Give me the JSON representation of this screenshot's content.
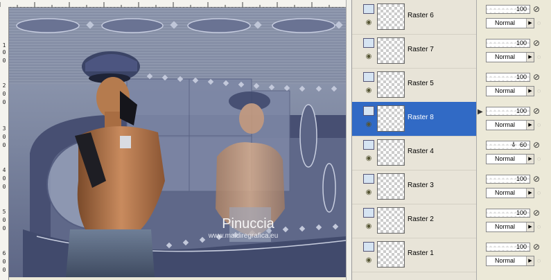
{
  "canvas": {
    "watermark_name": "Pinuccia",
    "watermark_url": "www.maidiregrafica.eu"
  },
  "ruler": {
    "left_ticks": [
      "1",
      "0",
      "0",
      "2",
      "0",
      "0",
      "3",
      "0",
      "0",
      "4",
      "0",
      "0",
      "5",
      "0",
      "0",
      "6",
      "0",
      "0"
    ]
  },
  "layers": [
    {
      "name": "Raster 6",
      "selected": false
    },
    {
      "name": "Raster 7",
      "selected": false
    },
    {
      "name": "Raster 5",
      "selected": false
    },
    {
      "name": "Raster 8",
      "selected": true
    },
    {
      "name": "Raster 4",
      "selected": false
    },
    {
      "name": "Raster 3",
      "selected": false
    },
    {
      "name": "Raster 2",
      "selected": false
    },
    {
      "name": "Raster 1",
      "selected": false
    }
  ],
  "props": [
    {
      "opacity": "100",
      "blend": "Normal"
    },
    {
      "opacity": "100",
      "blend": "Normal"
    },
    {
      "opacity": "100",
      "blend": "Normal"
    },
    {
      "opacity": "100",
      "blend": "Normal"
    },
    {
      "opacity": "60",
      "blend": "Normal"
    },
    {
      "opacity": "100",
      "blend": "Normal"
    },
    {
      "opacity": "100",
      "blend": "Normal"
    },
    {
      "opacity": "100",
      "blend": "Normal"
    }
  ],
  "colors": {
    "selection": "#316ac5",
    "panel_bg": "#ece9d8",
    "canvas_blue": "#4a5275"
  }
}
